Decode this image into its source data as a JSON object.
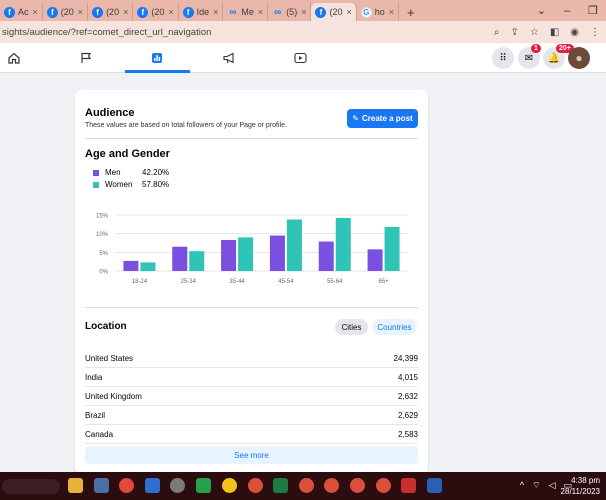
{
  "browser": {
    "tabs": [
      {
        "title": "Ac",
        "icon": "facebook-icon"
      },
      {
        "title": "(20",
        "icon": "facebook-icon"
      },
      {
        "title": "(20",
        "icon": "facebook-icon"
      },
      {
        "title": "(20",
        "icon": "facebook-icon"
      },
      {
        "title": "Ide",
        "icon": "facebook-icon"
      },
      {
        "title": "Me",
        "icon": "meta-icon"
      },
      {
        "title": "(5)",
        "icon": "meta-icon"
      },
      {
        "title": "(20",
        "icon": "facebook-icon"
      },
      {
        "title": "ho",
        "icon": "google-icon"
      }
    ],
    "new_tab": "+",
    "url": "sights/audience/?ref=comet_direct_url_navigation"
  },
  "fb_nav": {
    "messenger_badge": "1",
    "notifications_badge": "20+"
  },
  "audience": {
    "title": "Audience",
    "subtitle": "These values are based on total followers of your Page or profile.",
    "create_post": "Create a post"
  },
  "age_gender": {
    "title": "Age and Gender",
    "legend": [
      {
        "name": "Men",
        "pct": "42.20%",
        "color": "#7b4fe0"
      },
      {
        "name": "Women",
        "pct": "57.80%",
        "color": "#2ec4b6"
      }
    ]
  },
  "chart_data": {
    "type": "bar",
    "categories": [
      "18-24",
      "25-34",
      "35-44",
      "45-54",
      "55-64",
      "65+"
    ],
    "series": [
      {
        "name": "Men",
        "values": [
          2.7,
          6.5,
          8.3,
          9.5,
          7.9,
          5.8
        ]
      },
      {
        "name": "Women",
        "values": [
          2.3,
          5.3,
          9.0,
          13.8,
          14.2,
          11.8
        ]
      }
    ],
    "yticks": [
      "15%",
      "10%",
      "5%",
      "0%"
    ],
    "ylim": [
      0,
      15
    ],
    "colors": [
      "#7b4fe0",
      "#2ec4b6"
    ]
  },
  "location": {
    "title": "Location",
    "tab_cities": "Cities",
    "tab_countries": "Countries",
    "rows": [
      {
        "name": "United States",
        "value": "24,399"
      },
      {
        "name": "India",
        "value": "4,015"
      },
      {
        "name": "United Kingdom",
        "value": "2,632"
      },
      {
        "name": "Brazil",
        "value": "2,629"
      },
      {
        "name": "Canada",
        "value": "2,583"
      }
    ],
    "see_more": "See more"
  },
  "taskbar": {
    "time": "4:38 pm",
    "date": "28/11/2023"
  }
}
